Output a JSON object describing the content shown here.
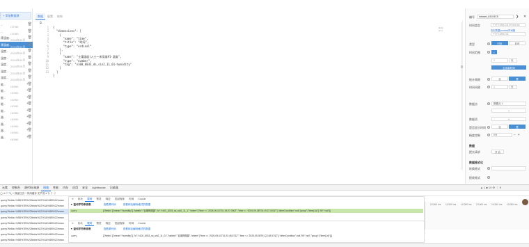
{
  "sidebar": {
    "add_label": "+ 添加数据源",
    "items": [
      {
        "name": "...",
        "date": "(3798)",
        "active": false
      },
      {
        "name": "...",
        "date": "(3788)",
        "active": false
      },
      {
        "name": "建温度...",
        "date": "2024年09月",
        "active": false
      },
      {
        "name": "建温度...",
        "date": "2024年09月",
        "active": true
      },
      {
        "name": "温度...",
        "date": "2024年09月",
        "active": false
      },
      {
        "name": "温度...",
        "date": "2024年09月",
        "active": false
      },
      {
        "name": "温度...",
        "date": "2024年09月",
        "active": false
      },
      {
        "name": "温度...",
        "date": "2024年09月",
        "active": false
      },
      {
        "name": "温度...",
        "date": "2024年09月",
        "active": false
      },
      {
        "name": "能...",
        "date": "(4096)",
        "active": false
      },
      {
        "name": "能...",
        "date": "(4096)",
        "active": false
      },
      {
        "name": "能...",
        "date": "(4096)",
        "active": false
      },
      {
        "name": "能...",
        "date": "(4096)",
        "active": false
      },
      {
        "name": "能...",
        "date": "(4096)",
        "active": false
      },
      {
        "name": "器...",
        "date": "(4096)",
        "active": false
      },
      {
        "name": "器...",
        "date": "(4096)",
        "active": false
      },
      {
        "name": "器...",
        "date": "(4096)",
        "active": false
      },
      {
        "name": "器...",
        "date": "(4096)",
        "active": false
      }
    ]
  },
  "tabs": [
    "数据",
    "配置",
    "结构"
  ],
  "code": {
    "line_numbers": [
      "1",
      "2",
      "3",
      "4",
      "5",
      "6",
      "7",
      "8",
      "9",
      "10",
      "11",
      "12",
      "13"
    ],
    "lines": [
      "{",
      "  \"dimensions\": [",
      "    {",
      "      \"name\": \"time\",",
      "      \"title\": \"时间\",",
      "      \"type\": \"ordinal\"",
      "    },",
      "    {",
      "      \"name\": \"土壤湿度(入土一米深度#1·温度\",",
      "      \"type\": \"number\",",
      "      \"tag\": \"x100_6033_ds_sin2_11_01-humidity\"",
      "    }",
      "  ]",
      "}"
    ]
  },
  "right": {
    "id_label": "编号",
    "id_value": "dataset_64104C8",
    "time_type_label": "时间类型",
    "time_type_value": "YYYY-MM-DD hh:mm:ss",
    "link_text": "历史数据(source)时间格",
    "time_format_value": "YYYY-MM-DD",
    "type_label": "类型",
    "type_opts": [
      "时序",
      "非时"
    ],
    "time_range_label": "时间范围",
    "unit_value": "天",
    "btn_blue": "生成新时间",
    "agg_label": "统计周期",
    "agg_opts": [
      "否",
      "是"
    ],
    "time_val_label": "时间间隔",
    "time_unit": "天",
    "group_label": "数据点",
    "group_value": "数据点 1",
    "add_btn": "+",
    "field_label": "数据项",
    "show_time_label": "是否显示时间",
    "show_opts": [
      "否",
      "是"
    ],
    "precision_label": "精度控制",
    "precision_value": "0%",
    "section": "数据",
    "sub_label": "提交请求",
    "sub_btn": "开 启",
    "format_section": "数据格式化",
    "sel_label": "转换格式",
    "param_label": "接收格式"
  },
  "devtools": {
    "tabs": [
      "元素",
      "控制台",
      "源代码/来源",
      "网络",
      "性能",
      "内存",
      "应用",
      "安全",
      "Lighthouse",
      "记录器"
    ],
    "active_tab": "网络",
    "toolbar": "◯  ⊘  ▽  🔍  □ 保留日志  □ 停用缓存  无节流  ▾  ⇅  ⇧  ⇩",
    "badges": "▲ 1  ■ 19  ⚙  ⋮  ✕",
    "requests": [
      "query?fields=%5B%7B%22fields%22%3A%5B%22mean",
      "query?fields=%5B%7B%22fields%22%3A%5B%22mean",
      "query?fields=%5B%7B%22fields%22%3A%5B%22mean",
      "query?fields=%5B%7B%22fields%22%3A%5B%22mean",
      "query?fields=%5B%7B%22fields%22%3A%5B%22mean",
      "query?fields=%5B%7B%22fields%22%3A%5B%22mean",
      "query?fields=%5B%7B%22fields%22%3A%5B%22mean",
      "query?fields=%5B%7B%22fields%22%3A%5B%22mean"
    ],
    "detail_tabs": [
      "✕",
      "标头",
      "载荷",
      "预览",
      "响应",
      "发起程序",
      "时间",
      "Cookie"
    ],
    "detail_active": "载荷",
    "section_title": "▼ 查询字符串参数",
    "view_source": "查看源代码",
    "view_decoded": "查看网址编码格式的数据",
    "query_key": "query",
    "query_value_1": "[{\"fields\":[{\"mean\":\"humidity\"}],\"tableId\":\"百湖神湖镇\",\"id\":\"x100_6033_ss_sin2_11_1\",\"where\":[\"time >= '2025-09-01T01:19:27.000Z'\",\"time <= '2025-09-08T01:19:27.000Z'\"],\"otherCondition\":null,\"group\":[\"time(1d)\"],\"fill\":\"null\"}]",
    "query_value_2": "[{\"fields\":[{\"mean\":\"humidity\"}],\"id\":\"x100_6033_ss_sin2_11_01\",\"tableId\":\"百湖神湖镇\",\"where\":[\"time >= '2025-09-01T01:22:45.574Z'\",\"time <= '2025-09-08T01:22:45.574Z'\"],\"otherCondition\":null,\"fill\":\"null\",\"group\":[\"time(1d)\"]}]",
    "timeline": [
      "10,000 ms",
      "11,000 ms",
      "12,000 ms",
      "13,000 ms",
      "14,000 ms",
      "15,000 ms"
    ]
  }
}
